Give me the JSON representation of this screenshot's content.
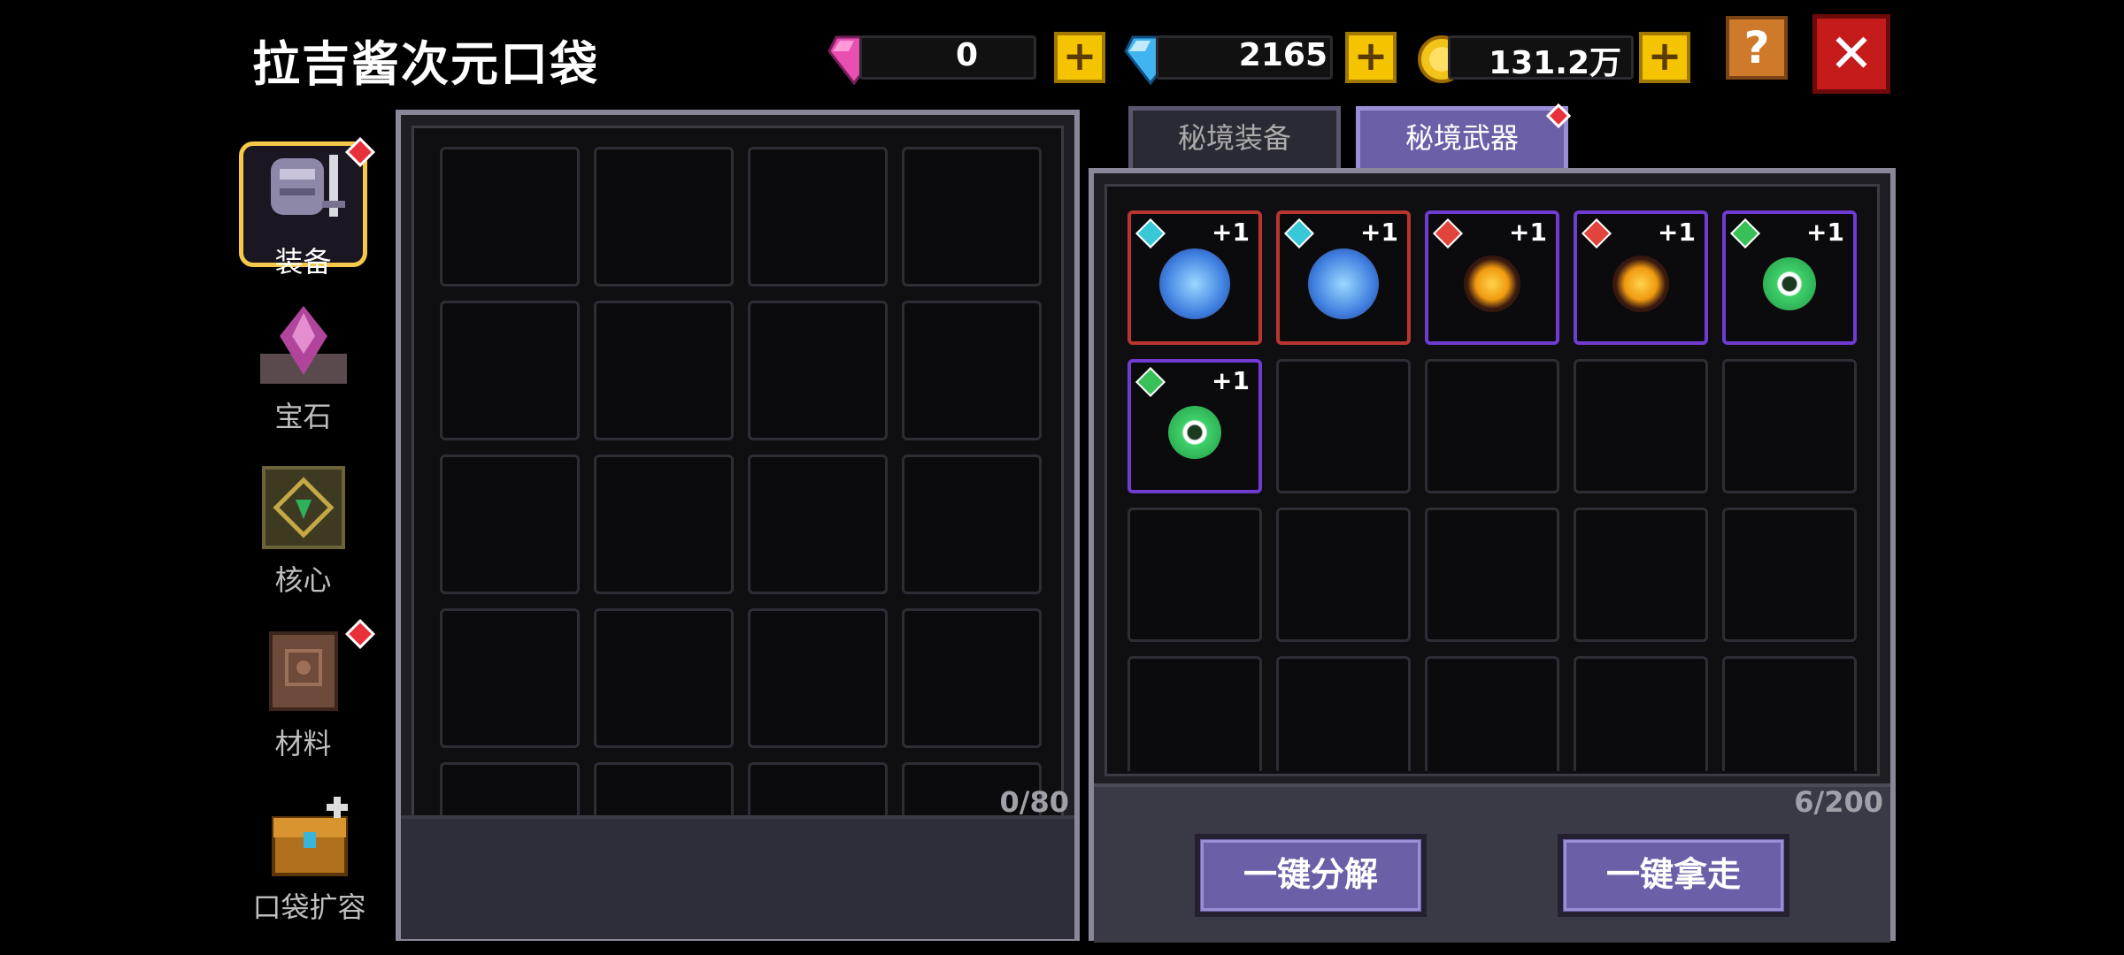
{
  "title": "拉吉酱次元口袋",
  "currencies": [
    {
      "name": "pink-gem",
      "value": "0",
      "color": "#e84fb0"
    },
    {
      "name": "blue-diamond",
      "value": "2165",
      "color": "#3fb4f0"
    },
    {
      "name": "gold-coin",
      "value": "131.2万",
      "color": "#f2c318"
    }
  ],
  "buttons": {
    "plus": "+",
    "help": "?",
    "close": "✕"
  },
  "sidebar": {
    "items": [
      {
        "label": "装备",
        "active": true,
        "badge": true
      },
      {
        "label": "宝石",
        "active": false,
        "badge": false
      },
      {
        "label": "核心",
        "active": false,
        "badge": false
      },
      {
        "label": "材料",
        "active": false,
        "badge": true
      },
      {
        "label": "口袋扩容",
        "active": false,
        "badge": false
      }
    ]
  },
  "left_panel": {
    "count": "0/80"
  },
  "tabs": [
    {
      "label": "秘境装备",
      "active": false
    },
    {
      "label": "秘境武器",
      "active": true
    }
  ],
  "right_panel": {
    "count": "6/200",
    "items": [
      {
        "level": "+1",
        "rarity": "red",
        "gem": "#38c8d8",
        "icon": "blue-orb-crystal"
      },
      {
        "level": "+1",
        "rarity": "red",
        "gem": "#38c8d8",
        "icon": "blue-orb-crystal"
      },
      {
        "level": "+1",
        "rarity": "purple",
        "gem": "#e0443c",
        "icon": "fire-eye-orb"
      },
      {
        "level": "+1",
        "rarity": "purple",
        "gem": "#e0443c",
        "icon": "fire-eye-orb"
      },
      {
        "level": "+1",
        "rarity": "purple",
        "gem": "#39c057",
        "icon": "green-eye-orb"
      },
      {
        "level": "+1",
        "rarity": "purple",
        "gem": "#39c057",
        "icon": "green-eye-orb"
      }
    ]
  },
  "actions": {
    "decompose": "一键分解",
    "take_all": "一键拿走"
  }
}
